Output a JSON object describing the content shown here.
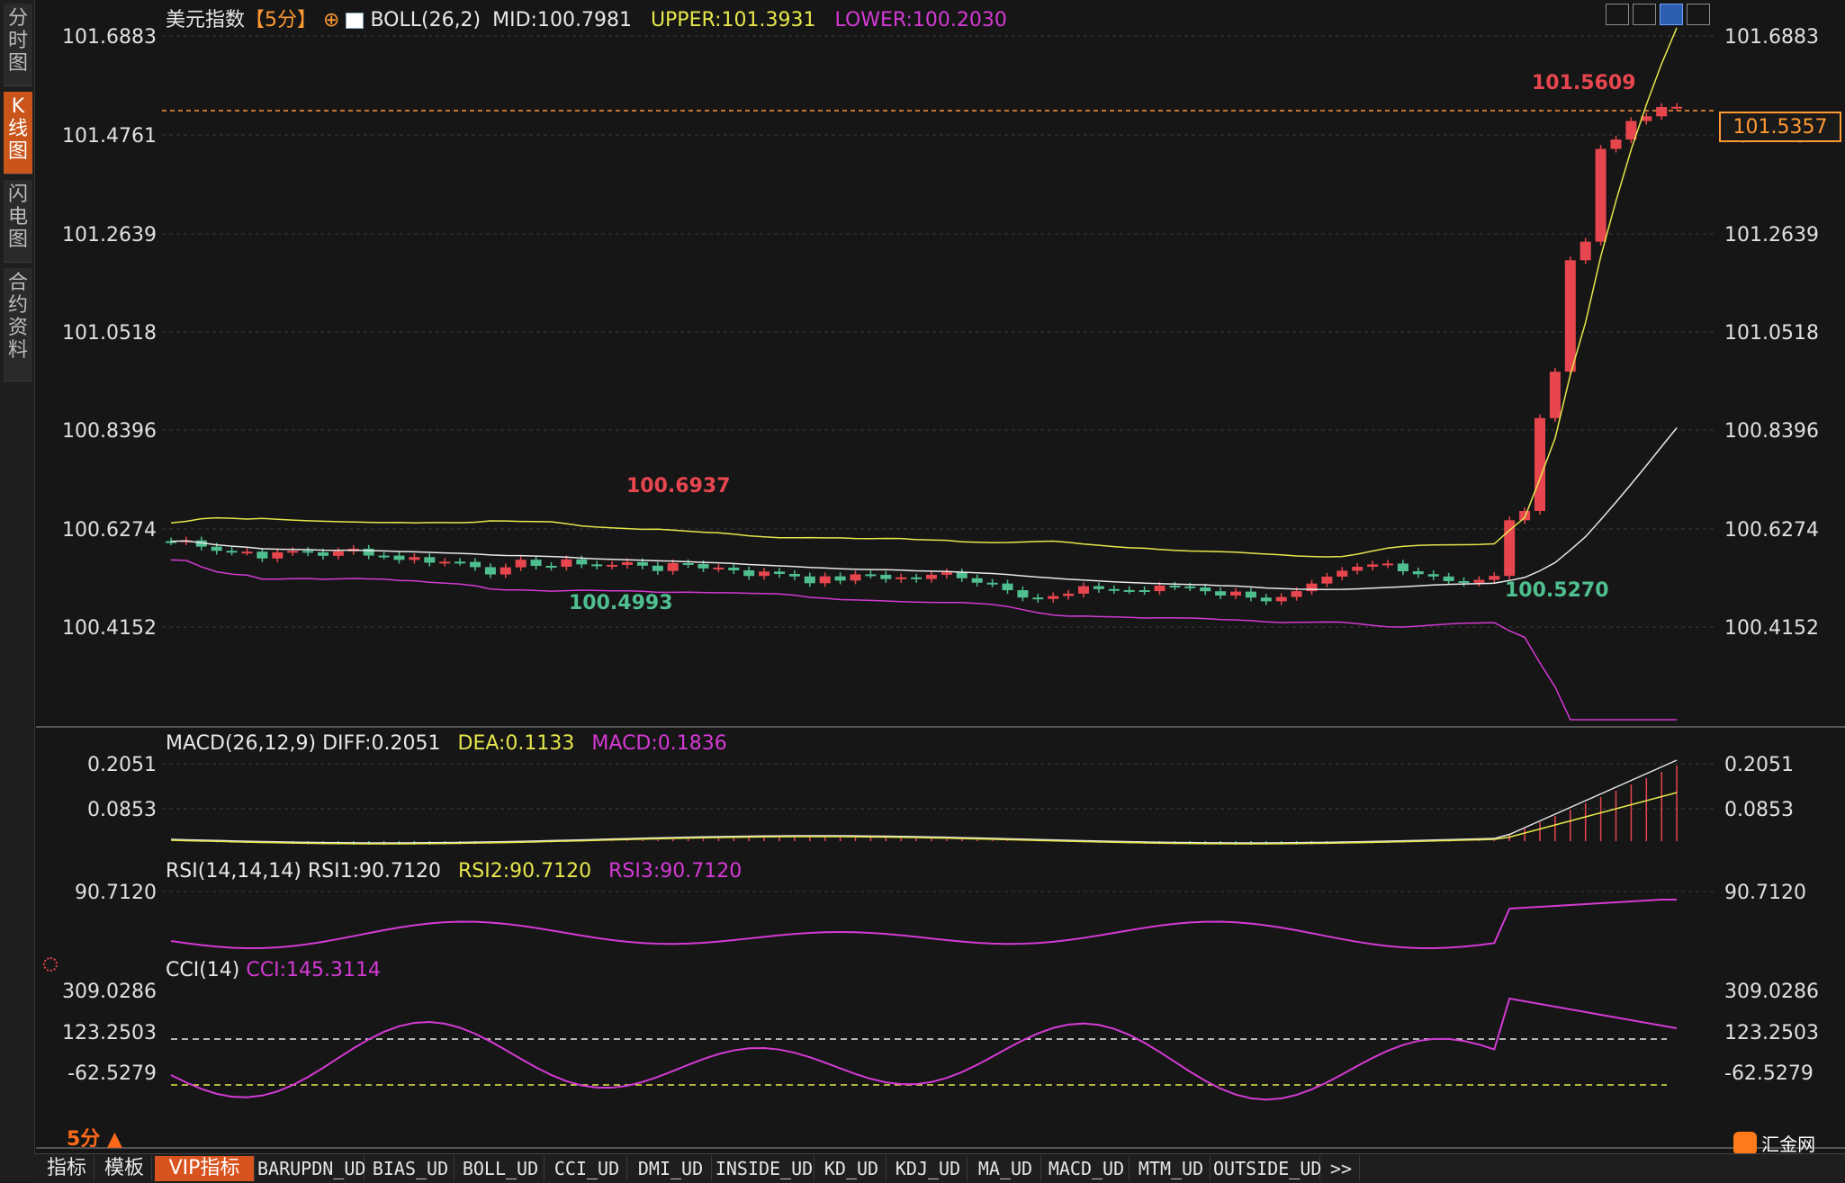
{
  "sidebar": {
    "tabs": [
      {
        "label": "分\n时\n图",
        "active": false
      },
      {
        "label": "K\n线\n图",
        "active": true
      },
      {
        "label": "闪\n电\n图",
        "active": false
      },
      {
        "label": "合\n约\n资\n料",
        "active": false
      }
    ]
  },
  "main": {
    "symbol": "美元指数",
    "period_tag": "【5分】",
    "boll_label": "BOLL(26,2)",
    "mid": "MID:100.7981",
    "upper": "UPPER:101.3931",
    "lower": "LOWER:100.2030",
    "last_price": "101.5357",
    "high_marker": "101.5609",
    "annotations": [
      "100.6937",
      "100.4993",
      "100.5270"
    ]
  },
  "macd": {
    "label": "MACD(26,12,9)",
    "diff": "DIFF:0.2051",
    "dea": "DEA:0.1133",
    "macd": "MACD:0.1836"
  },
  "rsi": {
    "label": "RSI(14,14,14)",
    "rsi1": "RSI1:90.7120",
    "rsi2": "RSI2:90.7120",
    "rsi3": "RSI3:90.7120"
  },
  "cci": {
    "label": "CCI(14)",
    "value": "CCI:145.3114"
  },
  "footer": {
    "period": "5分",
    "brand": "汇金网",
    "brand_url": "www.gold678.com"
  },
  "tabs": [
    "指标",
    "模板",
    "VIP指标",
    "BARUPDN_UD",
    "BIAS_UD",
    "BOLL_UD",
    "CCI_UD",
    "DMI_UD",
    "INSIDE_UD",
    "KD_UD",
    "KDJ_UD",
    "MA_UD",
    "MACD_UD",
    "MTM_UD",
    "OUTSIDE_UD",
    ">>"
  ],
  "colors": {
    "up": "#e8464e",
    "down": "#4fbf8f",
    "upper": "#e6e64c",
    "mid": "#e8e8e8",
    "lower": "#d43ad4",
    "accent": "#ff9933"
  },
  "chart_data": [
    {
      "type": "candlestick",
      "title": "美元指数【5分】",
      "ylim": [
        100.2,
        101.75
      ],
      "y_ticks": [
        "101.6883",
        "101.4761",
        "101.2639",
        "101.0518",
        "100.8396",
        "100.6274",
        "100.4152"
      ],
      "n_candles": 100,
      "series_bands": [
        "BOLL UPPER",
        "BOLL MID",
        "BOLL LOWER"
      ],
      "last_close": 101.5357,
      "period_high": 101.5609,
      "period_low": 100.4993
    },
    {
      "type": "bar",
      "title": "MACD(26,12,9)",
      "y_ticks": [
        "0.2051",
        "0.0853"
      ],
      "diff": 0.2051,
      "dea": 0.1133,
      "macd": 0.1836
    },
    {
      "type": "line",
      "title": "RSI(14,14,14)",
      "y_ticks": [
        "90.7120"
      ],
      "rsi1": 90.712,
      "rsi2": 90.712,
      "rsi3": 90.712
    },
    {
      "type": "line",
      "title": "CCI(14)",
      "y_ticks": [
        "309.0286",
        "123.2503",
        "-62.5279"
      ],
      "cci": 145.3114
    }
  ]
}
